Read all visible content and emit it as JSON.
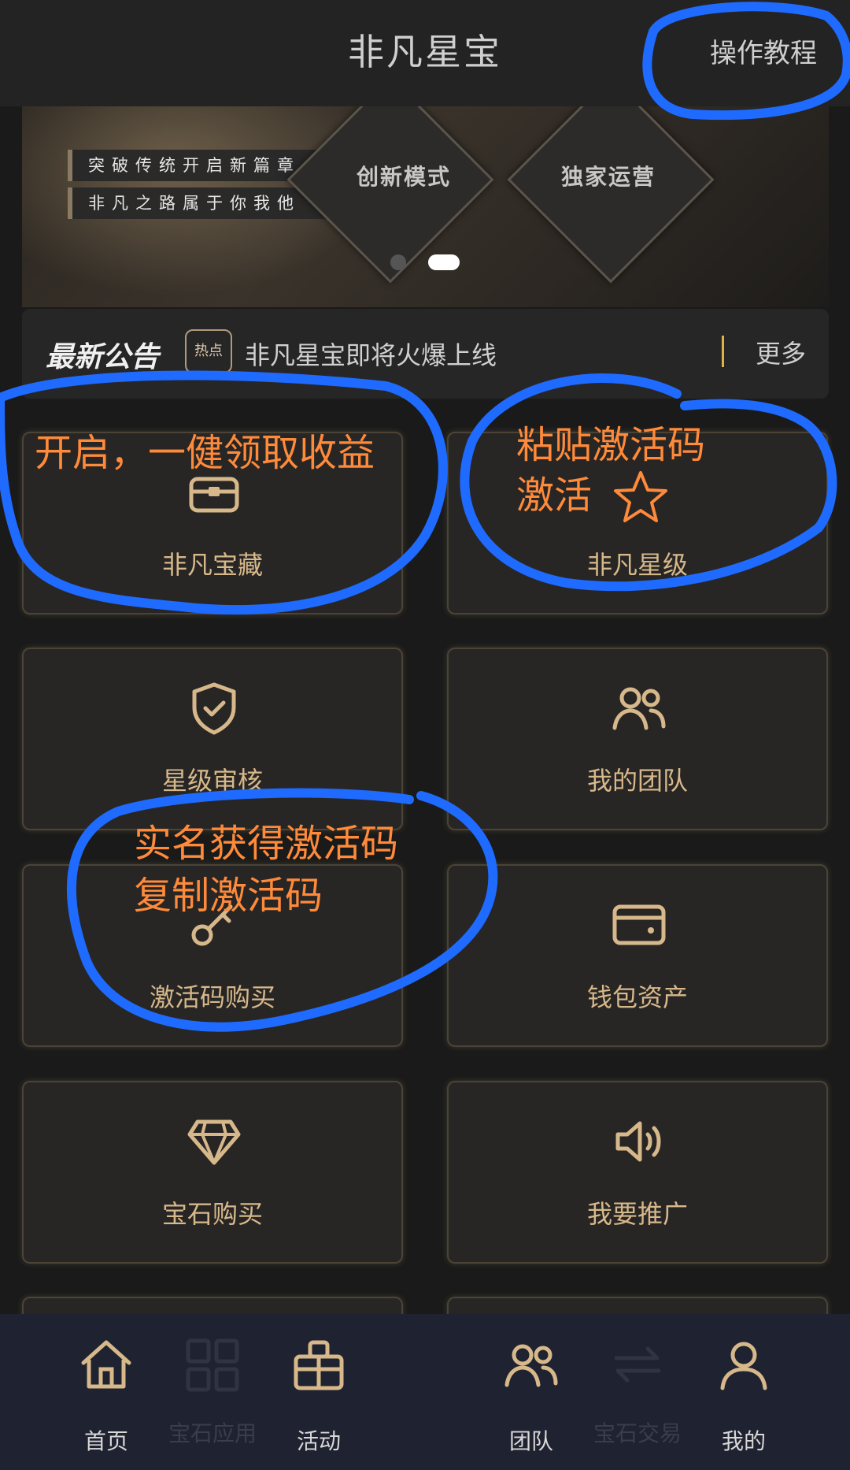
{
  "header": {
    "title": "非凡星宝",
    "tutorial_label": "操作教程"
  },
  "banner": {
    "slogans": [
      "突破传统开启新篇章",
      "非凡之路属于你我他"
    ],
    "diamond_labels": [
      "创新模式",
      "独家运营"
    ],
    "slides_total": 2,
    "active_slide": 2
  },
  "notice": {
    "title": "最新公告",
    "hot_badge": "热点",
    "text": "非凡星宝即将火爆上线",
    "more_label": "更多"
  },
  "tiles": [
    {
      "label": "非凡宝藏",
      "icon": "treasure-chest-icon"
    },
    {
      "label": "非凡星级",
      "icon": "star-icon"
    },
    {
      "label": "星级审核",
      "icon": "shield-check-icon"
    },
    {
      "label": "我的团队",
      "icon": "team-icon"
    },
    {
      "label": "激活码购买",
      "icon": "key-icon"
    },
    {
      "label": "钱包资产",
      "icon": "wallet-icon"
    },
    {
      "label": "宝石购买",
      "icon": "gem-icon"
    },
    {
      "label": "我要推广",
      "icon": "speaker-icon"
    }
  ],
  "annotations": {
    "a1": "开启，一健领取收益",
    "a2_line1": "粘贴激活码",
    "a2_line2": "激活",
    "a3_line1": "实名获得激活码",
    "a3_line2": "复制激活码"
  },
  "bottom_nav": [
    {
      "label": "首页",
      "icon": "home-icon"
    },
    {
      "label": "宝石应用",
      "icon": "grid-icon"
    },
    {
      "label": "活动",
      "icon": "gift-icon"
    },
    {
      "label": "团队",
      "icon": "team-icon"
    },
    {
      "label": "宝石交易",
      "icon": "exchange-icon"
    },
    {
      "label": "我的",
      "icon": "user-icon"
    }
  ],
  "colors": {
    "accent_gold": "#d7b88a",
    "annotation_orange": "#ff8a3a",
    "scribble_blue": "#1f6bff",
    "background": "#1a1a1a"
  }
}
